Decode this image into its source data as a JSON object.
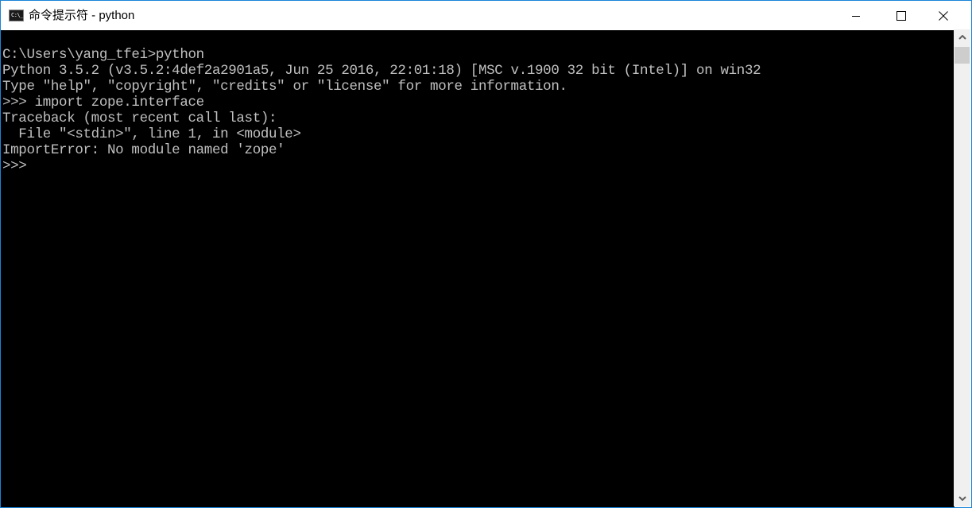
{
  "window": {
    "title": "命令提示符 - python",
    "app_icon_label": "C:\\_",
    "controls": {
      "minimize": "minimize",
      "maximize": "maximize",
      "close": "close"
    }
  },
  "console": {
    "lines": [
      "C:\\Users\\yang_tfei>python",
      "Python 3.5.2 (v3.5.2:4def2a2901a5, Jun 25 2016, 22:01:18) [MSC v.1900 32 bit (Intel)] on win32",
      "Type \"help\", \"copyright\", \"credits\" or \"license\" for more information.",
      ">>> import zope.interface",
      "Traceback (most recent call last):",
      "  File \"<stdin>\", line 1, in <module>",
      "ImportError: No module named 'zope'",
      ">>>"
    ],
    "colors": {
      "background": "#000000",
      "foreground": "#c0c0c0"
    }
  },
  "scrollbar": {
    "position_fraction": 0.0
  }
}
